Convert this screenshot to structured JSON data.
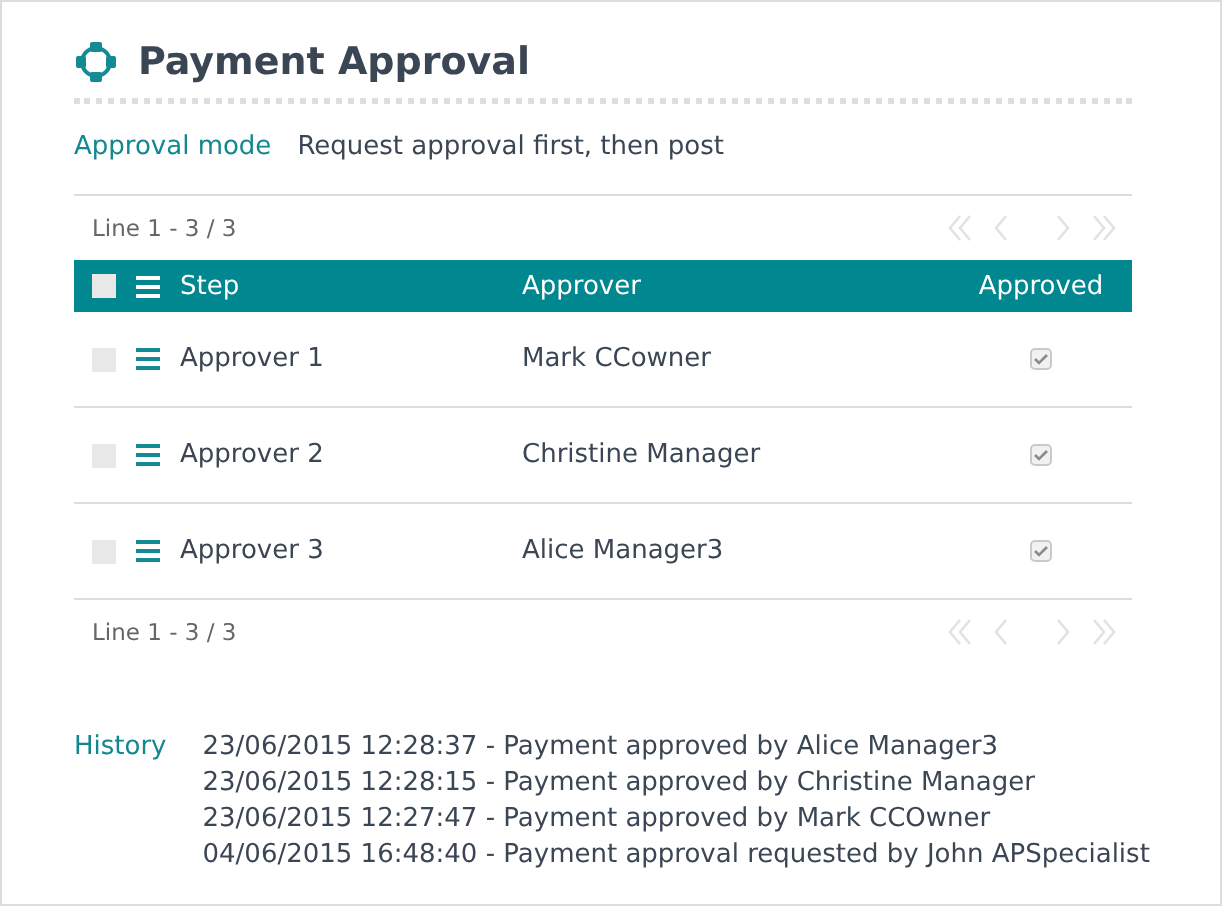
{
  "title": "Payment Approval",
  "approval_mode": {
    "label": "Approval mode",
    "value": "Request approval first, then post"
  },
  "table": {
    "pager_top": "Line 1 - 3 / 3",
    "pager_bottom": "Line 1 - 3 / 3",
    "columns": [
      "Step",
      "Approver",
      "Approved"
    ],
    "all_selected": false,
    "rows": [
      {
        "step": "Approver 1",
        "approver": "Mark CCowner",
        "approved": true,
        "selected": false
      },
      {
        "step": "Approver 2",
        "approver": "Christine Manager",
        "approved": true,
        "selected": false
      },
      {
        "step": "Approver 3",
        "approver": "Alice Manager3",
        "approved": true,
        "selected": false
      }
    ]
  },
  "history": {
    "label": "History",
    "entries": [
      "23/06/2015 12:28:37 - Payment approved by Alice Manager3",
      "23/06/2015 12:28:15 - Payment approved by Christine Manager",
      "23/06/2015 12:27:47 - Payment approved by Mark CCOwner",
      "04/06/2015 16:48:40 - Payment approval requested by John APSpecialist"
    ]
  }
}
